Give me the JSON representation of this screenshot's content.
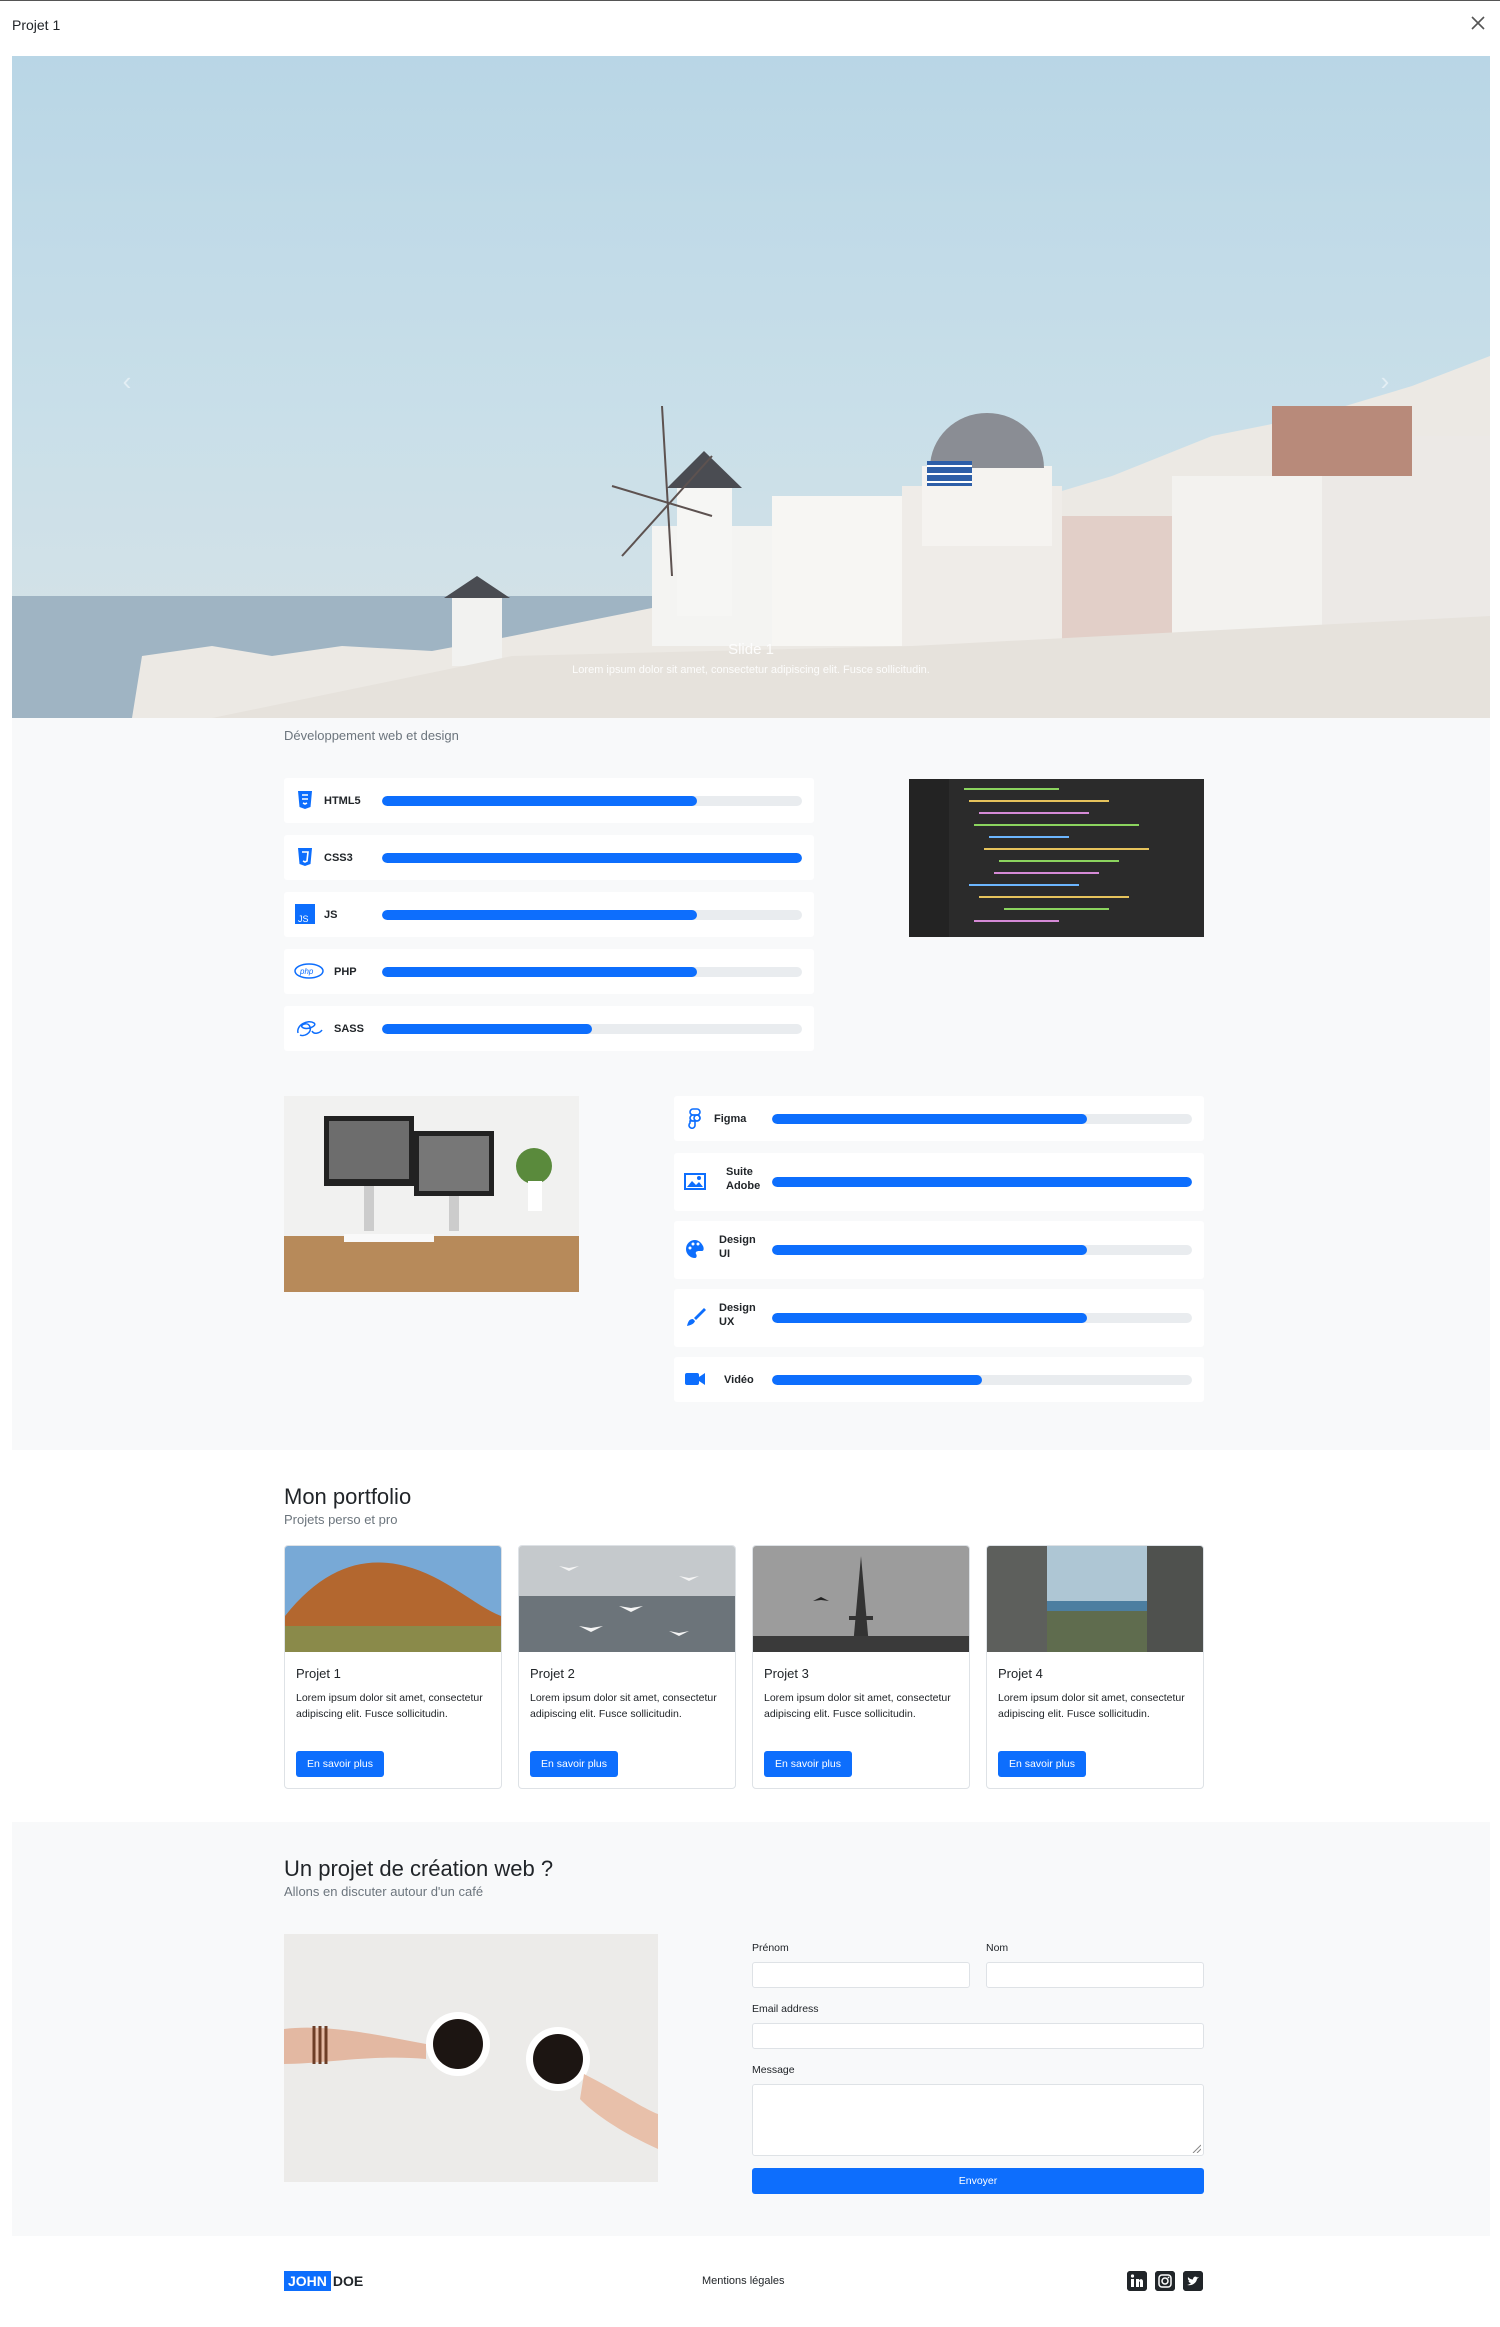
{
  "window": {
    "title": "Projet 1"
  },
  "hero": {
    "caption_title": "Slide 1",
    "caption_text": "Lorem ipsum dolor sit amet, consectetur adipiscing elit. Fusce sollicitudin."
  },
  "skills": {
    "subtitle": "Développement web et design",
    "dev": [
      {
        "icon": "html5-icon",
        "label": "HTML5",
        "level": 0.75
      },
      {
        "icon": "css3-icon",
        "label": "CSS3",
        "level": 1.0
      },
      {
        "icon": "js-icon",
        "label": "JS",
        "level": 0.75
      },
      {
        "icon": "php-icon",
        "label": "PHP",
        "level": 0.75
      },
      {
        "icon": "sass-icon",
        "label": "SASS",
        "level": 0.5
      }
    ],
    "design": [
      {
        "icon": "figma-icon",
        "label": "Figma",
        "level": 0.75
      },
      {
        "icon": "image-icon",
        "label": "Suite Adobe",
        "level": 1.0
      },
      {
        "icon": "palette-icon",
        "label": "Design UI",
        "level": 0.75
      },
      {
        "icon": "brush-icon",
        "label": "Design UX",
        "level": 0.75
      },
      {
        "icon": "video-icon",
        "label": "Vidéo",
        "level": 0.5
      }
    ]
  },
  "portfolio": {
    "title": "Mon portfolio",
    "subtitle": "Projets perso et pro",
    "cards": [
      {
        "title": "Projet 1",
        "text": "Lorem ipsum dolor sit amet, consectetur adipiscing elit. Fusce sollicitudin.",
        "button": "En savoir plus"
      },
      {
        "title": "Projet 2",
        "text": "Lorem ipsum dolor sit amet, consectetur adipiscing elit. Fusce sollicitudin.",
        "button": "En savoir plus"
      },
      {
        "title": "Projet 3",
        "text": "Lorem ipsum dolor sit amet, consectetur adipiscing elit. Fusce sollicitudin.",
        "button": "En savoir plus"
      },
      {
        "title": "Projet 4",
        "text": "Lorem ipsum dolor sit amet, consectetur adipiscing elit. Fusce sollicitudin.",
        "button": "En savoir plus"
      }
    ]
  },
  "contact": {
    "title": "Un projet de création web ?",
    "subtitle": "Allons en discuter autour d'un café",
    "fields": {
      "firstname": "Prénom",
      "lastname": "Nom",
      "email": "Email address",
      "message": "Message"
    },
    "submit": "Envoyer"
  },
  "footer": {
    "logo_first": "JOHN",
    "logo_last": "DOE",
    "legal": "Mentions légales",
    "social": [
      "linkedin-icon",
      "instagram-icon",
      "twitter-icon"
    ]
  },
  "colors": {
    "accent": "#0d6efd",
    "section_bg": "#f8f9fa",
    "track": "#e9ecef"
  }
}
